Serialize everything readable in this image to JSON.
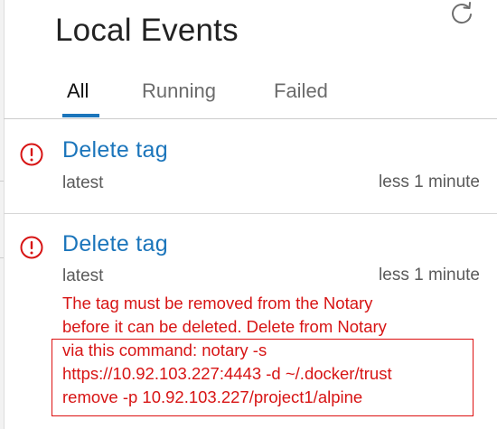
{
  "header": {
    "title": "Local Events",
    "refresh_icon": "refresh-icon"
  },
  "tabs": [
    {
      "label": "All",
      "active": true
    },
    {
      "label": "Running",
      "active": false
    },
    {
      "label": "Failed",
      "active": false
    }
  ],
  "events": [
    {
      "icon": "error-circle-icon",
      "title": "Delete tag",
      "subtitle": "latest",
      "time": "less 1 minute"
    },
    {
      "icon": "error-circle-icon",
      "title": "Delete tag",
      "subtitle": "latest",
      "time": "less 1 minute",
      "error_lines": [
        "The tag must be removed from the Notary",
        "before it can be deleted. Delete from Notary",
        "via this command: notary -s",
        "https://10.92.103.227:4443 -d ~/.docker/trust",
        "remove -p 10.92.103.227/project1/alpine"
      ]
    }
  ],
  "colors": {
    "accent": "#1b75bb",
    "error": "#d71414",
    "text": "#222222",
    "muted": "#5a5a5a"
  }
}
